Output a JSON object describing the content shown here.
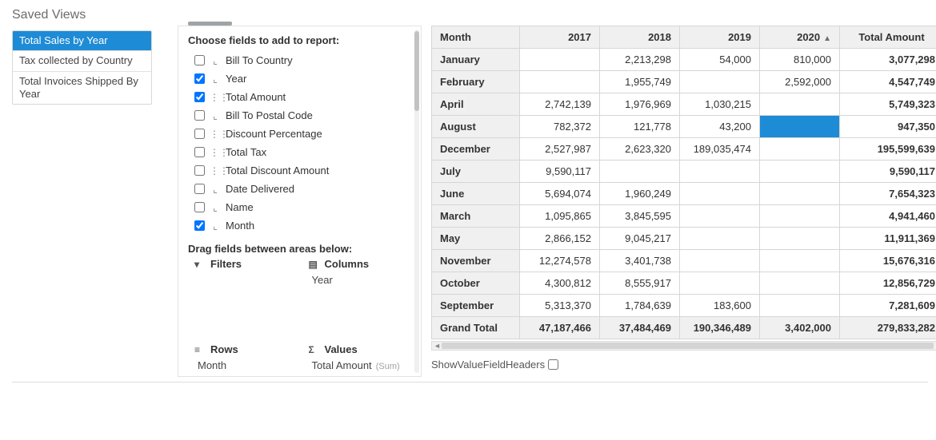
{
  "sidebar": {
    "title": "Saved Views",
    "views": [
      {
        "label": "Total Sales by Year",
        "selected": true
      },
      {
        "label": "Tax collected by Country",
        "selected": false
      },
      {
        "label": "Total Invoices Shipped By Year",
        "selected": false
      }
    ]
  },
  "config": {
    "choose_title": "Choose fields to add to report:",
    "fields": [
      {
        "label": "Bill To Country",
        "checked": false,
        "icon": "text"
      },
      {
        "label": "Year",
        "checked": true,
        "icon": "text"
      },
      {
        "label": "Total Amount",
        "checked": true,
        "icon": "numeric"
      },
      {
        "label": "Bill To Postal Code",
        "checked": false,
        "icon": "text"
      },
      {
        "label": "Discount Percentage",
        "checked": false,
        "icon": "numeric"
      },
      {
        "label": "Total Tax",
        "checked": false,
        "icon": "numeric"
      },
      {
        "label": "Total Discount Amount",
        "checked": false,
        "icon": "numeric"
      },
      {
        "label": "Date Delivered",
        "checked": false,
        "icon": "text"
      },
      {
        "label": "Name",
        "checked": false,
        "icon": "text"
      },
      {
        "label": "Month",
        "checked": true,
        "icon": "text"
      }
    ],
    "drag_title": "Drag fields between areas below:",
    "areas": {
      "filters": {
        "title": "Filters",
        "icon": "filter",
        "items": []
      },
      "columns": {
        "title": "Columns",
        "icon": "columns",
        "items": [
          "Year"
        ]
      },
      "rows": {
        "title": "Rows",
        "icon": "rows",
        "items": [
          "Month"
        ]
      },
      "values": {
        "title": "Values",
        "icon": "sigma",
        "items": [
          "Total Amount"
        ],
        "agg": "(Sum)"
      }
    }
  },
  "pivot": {
    "row_header": "Month",
    "col_group": "Year",
    "years": [
      "2017",
      "2018",
      "2019",
      "2020"
    ],
    "total_header": "Total Amount",
    "sort_col_index": 3,
    "highlight": {
      "row": 3,
      "col": 3
    },
    "rows": [
      {
        "label": "January",
        "cells": [
          "",
          "2,213,298",
          "54,000",
          "810,000"
        ],
        "total": "3,077,298"
      },
      {
        "label": "February",
        "cells": [
          "",
          "1,955,749",
          "",
          "2,592,000"
        ],
        "total": "4,547,749"
      },
      {
        "label": "April",
        "cells": [
          "2,742,139",
          "1,976,969",
          "1,030,215",
          ""
        ],
        "total": "5,749,323"
      },
      {
        "label": "August",
        "cells": [
          "782,372",
          "121,778",
          "43,200",
          ""
        ],
        "total": "947,350"
      },
      {
        "label": "December",
        "cells": [
          "2,527,987",
          "2,623,320",
          "189,035,474",
          ""
        ],
        "total": "195,599,639"
      },
      {
        "label": "July",
        "cells": [
          "9,590,117",
          "",
          "",
          ""
        ],
        "total": "9,590,117"
      },
      {
        "label": "June",
        "cells": [
          "5,694,074",
          "1,960,249",
          "",
          ""
        ],
        "total": "7,654,323"
      },
      {
        "label": "March",
        "cells": [
          "1,095,865",
          "3,845,595",
          "",
          ""
        ],
        "total": "4,941,460"
      },
      {
        "label": "May",
        "cells": [
          "2,866,152",
          "9,045,217",
          "",
          ""
        ],
        "total": "11,911,369"
      },
      {
        "label": "November",
        "cells": [
          "12,274,578",
          "3,401,738",
          "",
          ""
        ],
        "total": "15,676,316"
      },
      {
        "label": "October",
        "cells": [
          "4,300,812",
          "8,555,917",
          "",
          ""
        ],
        "total": "12,856,729"
      },
      {
        "label": "September",
        "cells": [
          "5,313,370",
          "1,784,639",
          "183,600",
          ""
        ],
        "total": "7,281,609"
      }
    ],
    "grand_total": {
      "label": "Grand Total",
      "cells": [
        "47,187,466",
        "37,484,469",
        "190,346,489",
        "3,402,000"
      ],
      "total": "279,833,282"
    },
    "show_value_headers_label": "ShowValueFieldHeaders",
    "show_value_headers_checked": false
  },
  "icons": {
    "text": "⌞",
    "numeric": "⋮⋮",
    "filter": "▾",
    "columns": "▤",
    "rows": "≡",
    "sigma": "Σ",
    "sort_asc": "▲"
  }
}
